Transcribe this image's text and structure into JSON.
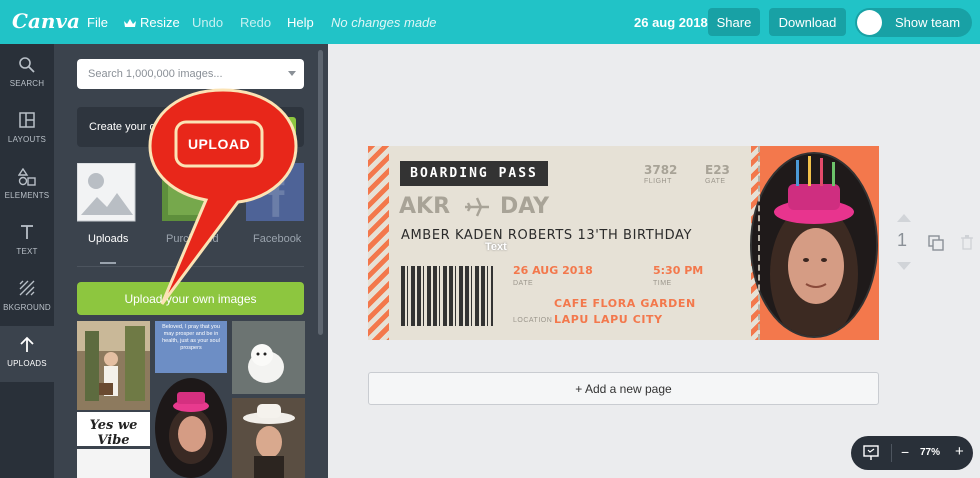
{
  "topbar": {
    "logo": "Canva",
    "file": "File",
    "resize": "Resize",
    "undo": "Undo",
    "redo": "Redo",
    "help": "Help",
    "status": "No changes made",
    "date": "26 aug 2018",
    "share": "Share",
    "download": "Download",
    "show_team": "Show team"
  },
  "leftnav": {
    "items": [
      {
        "label": "SEARCH",
        "icon": "search-icon"
      },
      {
        "label": "LAYOUTS",
        "icon": "layouts-icon"
      },
      {
        "label": "ELEMENTS",
        "icon": "elements-icon"
      },
      {
        "label": "TEXT",
        "icon": "text-icon"
      },
      {
        "label": "BKGROUND",
        "icon": "background-icon"
      },
      {
        "label": "UPLOADS",
        "icon": "upload-icon",
        "active": true
      }
    ]
  },
  "panel": {
    "search_placeholder": "Search 1,000,000 images...",
    "create_text": "Create your own",
    "tiles": [
      {
        "label": "Uploads"
      },
      {
        "label": "Purchased"
      },
      {
        "label": "Facebook"
      }
    ],
    "upload_button": "Upload your own images",
    "quote_text": "Beloved, I pray that you may prosper and be in health, just as your soul prospers",
    "vibe_text": "Yes we Vibe"
  },
  "callout": {
    "label": "UPLOAD"
  },
  "ticket": {
    "title": "BOARDING PASS",
    "flight_no": "3782",
    "flight_lbl": "FLIGHT",
    "gate_no": "E23",
    "gate_lbl": "GATE",
    "from": "AKR",
    "to": "DAY",
    "name": "AMBER KADEN ROBERTS 13'TH BIRTHDAY",
    "date": "26 AUG 2018",
    "date_lbl": "DATE",
    "time": "5:30 PM",
    "time_lbl": "TIME",
    "location_lbl": "LOCATION",
    "location_1": "CAFE FLORA GARDEN",
    "location_2": "LAPU LAPU CITY",
    "overlay_text": "Text"
  },
  "canvas": {
    "add_page": "+ Add a new page",
    "page_number": "1"
  },
  "zoom": {
    "minus": "−",
    "value": "77%",
    "plus": "+"
  },
  "colors": {
    "topbar": "#21c3c7",
    "accent_green": "#8dc63f",
    "ticket_orange": "#f3784c",
    "callout_red": "#e8271a"
  }
}
